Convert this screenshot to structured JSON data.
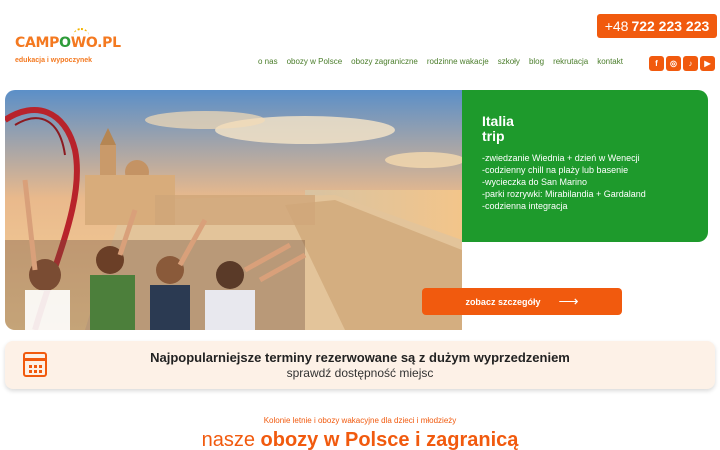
{
  "logo": {
    "part1": "CAMP",
    "part2": "O",
    "part3": "WO.PL",
    "tagline": "edukacja i wypoczynek"
  },
  "header": {
    "phone_prefix": "+48",
    "phone_number": "722 223 223"
  },
  "nav": {
    "items": [
      "o nas",
      "obozy w Polsce",
      "obozy zagraniczne",
      "rodzinne wakacje",
      "szkoły",
      "blog",
      "rekrutacja",
      "kontakt"
    ]
  },
  "social": {
    "facebook": "f",
    "instagram": "◎",
    "tiktok": "♪",
    "youtube": "▶"
  },
  "hero": {
    "title_line1": "Italia",
    "title_line2": "trip",
    "items": [
      "-zwiedzanie Wiednia + dzień w Wenecji",
      "-codzienny chill na plaży lub basenie",
      "-wycieczka do San Marino",
      "-parki rozrywki: Mirabilandia + Gardaland",
      "-codzienna integracja"
    ],
    "button_label": "zobacz szczegóły"
  },
  "banner": {
    "title": "Najpopularniejsze terminy rezerwowane są z dużym wyprzedzeniem",
    "subtitle": "sprawdź dostępność miejsc"
  },
  "section": {
    "subtitle": "Kolonie letnie i obozy wakacyjne dla dzieci i młodzieży",
    "title_prefix": "nasze",
    "title_bold": "obozy w Polsce i zagranicą"
  },
  "colors": {
    "accent": "#f15a0e",
    "green": "#1e9a2c"
  }
}
